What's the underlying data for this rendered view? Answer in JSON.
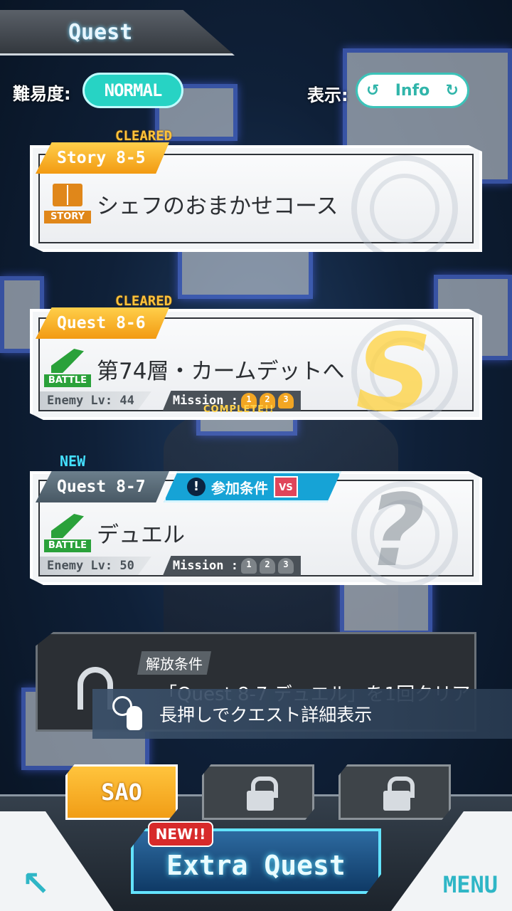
{
  "header": {
    "title": "Quest"
  },
  "difficulty": {
    "label": "難易度:",
    "value": "NORMAL"
  },
  "view": {
    "label": "表示:",
    "value": "Info",
    "prev_icon": "cycle-left-icon",
    "next_icon": "cycle-right-icon"
  },
  "quests": [
    {
      "status": "CLEARED",
      "id": "Story 8-5",
      "type": "STORY",
      "name": "シェフのおまかせコース"
    },
    {
      "status": "CLEARED",
      "id": "Quest 8-6",
      "type": "BATTLE",
      "name": "第74層・カームデットへ",
      "enemy_lv": "Enemy Lv: 44",
      "mission_label": "Mission :",
      "mission_state": "COMPLETE!!",
      "rank": "S",
      "trophies": [
        "1",
        "2",
        "3"
      ]
    },
    {
      "status": "NEW",
      "id": "Quest 8-7",
      "type": "BATTLE",
      "name": "デュエル",
      "condition_label": "参加条件",
      "condition_badge": "VS",
      "enemy_lv": "Enemy Lv: 50",
      "mission_label": "Mission :",
      "rank": "?",
      "trophies": [
        "1",
        "2",
        "3"
      ]
    }
  ],
  "locked_quest": {
    "tag": "解放条件",
    "text": "「Quest 8-7 デュエル」を1回クリア"
  },
  "hint": {
    "text": "長押しでクエスト詳細表示"
  },
  "worlds": [
    {
      "label": "SAO",
      "active": true
    },
    {
      "label": "",
      "locked": true
    },
    {
      "label": "",
      "locked": true
    }
  ],
  "footer": {
    "extra_quest": "Extra Quest",
    "new_badge": "NEW!!",
    "menu": "MENU",
    "back_symbol": "↖"
  },
  "colors": {
    "accent_gold": "#f29a12",
    "accent_cyan": "#27d3c4",
    "battle_green": "#2aa13a",
    "story_orange": "#e0871a"
  }
}
